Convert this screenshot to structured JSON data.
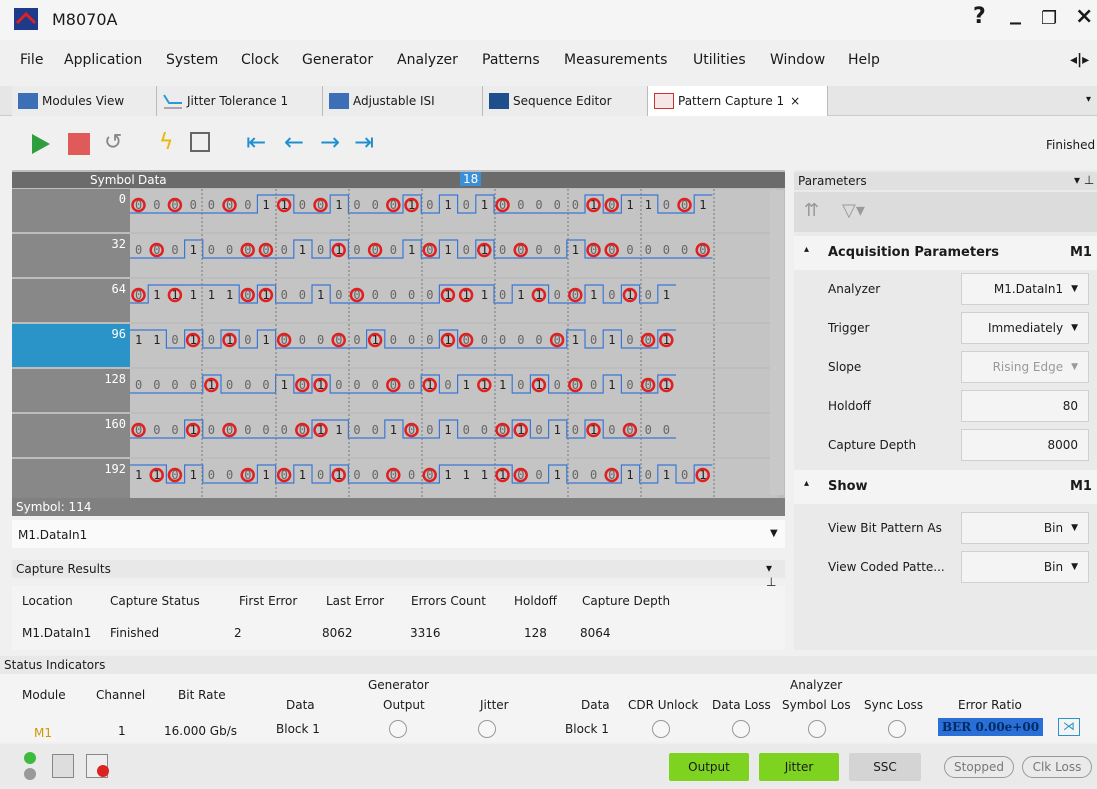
{
  "app": {
    "title": "M8070A",
    "help": "?",
    "minimize": "_",
    "restore": "❐",
    "close": "×"
  },
  "menu": [
    "File",
    "Application",
    "System",
    "Clock",
    "Generator",
    "Analyzer",
    "Patterns",
    "Measurements",
    "Utilities",
    "Window",
    "Help"
  ],
  "tabs": [
    {
      "label": "Modules View",
      "icon": "modules-icon"
    },
    {
      "label": "Jitter Tolerance 1",
      "icon": "jitter-chart-icon"
    },
    {
      "label": "Adjustable ISI",
      "icon": "modules-icon"
    },
    {
      "label": "Sequence Editor",
      "icon": "binary-icon"
    },
    {
      "label": "Pattern Capture 1",
      "icon": "pattern-capture-icon",
      "close": "×",
      "active": true
    }
  ],
  "toolbar": {
    "status": "Finished",
    "icons": [
      "play-icon",
      "stop-icon",
      "undo-icon",
      "lightning-icon",
      "save-icon",
      "first-icon",
      "prev-icon",
      "next-icon",
      "last-icon"
    ]
  },
  "grid": {
    "header": {
      "symbol": "Symbol",
      "data": "Data",
      "marker": "18"
    },
    "rows": [
      {
        "symbol": "0",
        "bits": "0 0 0 0 0 0 0 1 1 0 0 1 0 0 0 1 0 1 0 1 0 0 0 0 0 1 0 1 1 0 0 1"
      },
      {
        "symbol": "32",
        "bits": "0 0 0 1 0 0 0 0 0 1 0 1 0 0 0 1 0 1 0 1 0 0 0 0 1 0 0 0 0 0 0 0"
      },
      {
        "symbol": "64",
        "bits": "0 1 1 1 1 1 0 1 0 0 1 0 0 0 0 0 0 1 1 1 0 1 1 0 0 1 0 1 0 1"
      },
      {
        "symbol": "96",
        "bits": "1 1 0 1 0 1 0 1 0 0 0 0 0 1 0 0 0 1 0 0 0 0 0 0 1 0 1 0 0 1"
      },
      {
        "symbol": "128",
        "bits": "0 0 0 0 1 0 0 0 1 0 1 0 0 0 0 0 1 0 1 1 1 0 1 0 0 0 1 0 0 1"
      },
      {
        "symbol": "160",
        "bits": "0 0 0 1 0 0 0 0 0 0 1 1 0 0 1 0 0 1 0 0 0 1 0 1 0 1 0 0 0 0"
      },
      {
        "symbol": "192",
        "bits": "1 1 0 1 0 0 0 1 0 1 0 1 0 0 0 0 0 1 1 1 1 0 0 1 0 0 0 1 0 1 0 1"
      }
    ],
    "footer": "Symbol: 114"
  },
  "channel_select": "M1.DataIn1",
  "capture_results": {
    "title": "Capture Results",
    "headers": [
      "Location",
      "Capture Status",
      "First Error",
      "Last Error",
      "Errors Count",
      "Holdoff",
      "Capture Depth"
    ],
    "row": [
      "M1.DataIn1",
      "Finished",
      "2",
      "8062",
      "3316",
      "128",
      "8064"
    ]
  },
  "params": {
    "title": "Parameters",
    "acq_title": "Acquisition Parameters",
    "acq_module": "M1",
    "fields": [
      {
        "label": "Analyzer",
        "value": "M1.DataIn1",
        "dropdown": true
      },
      {
        "label": "Trigger",
        "value": "Immediately",
        "dropdown": true
      },
      {
        "label": "Slope",
        "value": "Rising Edge",
        "dropdown": true,
        "disabled": true
      },
      {
        "label": "Holdoff",
        "value": "80"
      },
      {
        "label": "Capture Depth",
        "value": "8000"
      }
    ],
    "show_title": "Show",
    "show_module": "M1",
    "show_fields": [
      {
        "label": "View Bit Pattern As",
        "value": "Bin"
      },
      {
        "label": "View Coded Patte...",
        "value": "Bin"
      }
    ]
  },
  "status": {
    "title": "Status Indicators",
    "headers": {
      "module": "Module",
      "channel": "Channel",
      "bitrate": "Bit Rate",
      "generator": "Generator",
      "g_data": "Data",
      "g_output": "Output",
      "g_jitter": "Jitter",
      "analyzer": "Analyzer",
      "a_data": "Data",
      "cdr": "CDR Unlock",
      "dataloss": "Data Loss",
      "symlos": "Symbol Los",
      "synclos": "Sync Loss",
      "ber": "Error Ratio"
    },
    "row": {
      "module": "M1",
      "channel": "1",
      "bitrate": "16.000 Gb/s",
      "g_data": "Block 1",
      "a_data": "Block 1",
      "ber": "BER 0.00e+00"
    }
  },
  "bottom": {
    "output": "Output",
    "jitter": "Jitter",
    "ssc": "SSC",
    "stopped": "Stopped",
    "clkloss": "Clk Loss"
  },
  "colors": {
    "accent": "#2a93c8",
    "green_btn": "#7ed321",
    "marker": "#3a8fd6",
    "error": "#e02020"
  }
}
